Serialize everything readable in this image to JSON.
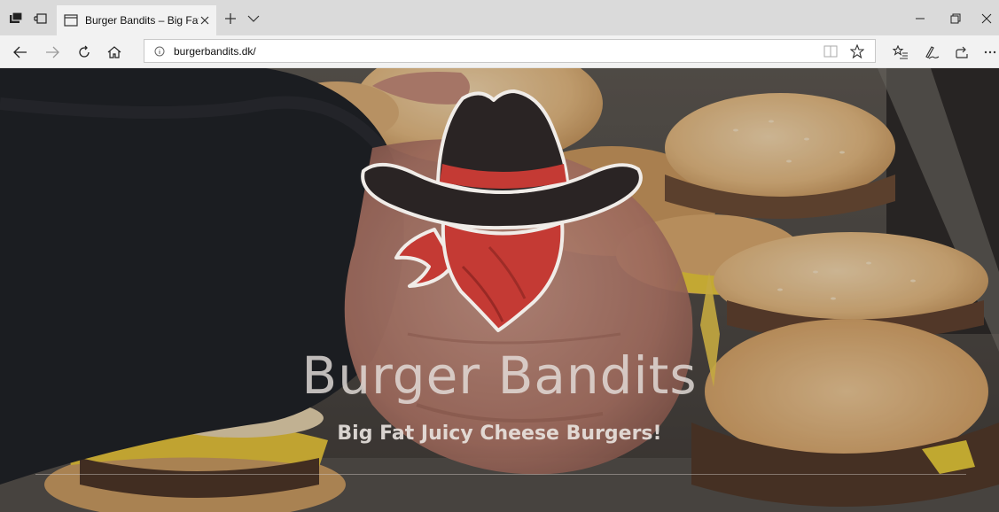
{
  "browser": {
    "tab": {
      "title": "Burger Bandits – Big Fat"
    },
    "address": {
      "url": "burgerbandits.dk/"
    },
    "icons": {
      "set_aside": "set-aside-tabs-icon",
      "tab_preview": "tab-preview-icon",
      "page": "page-icon",
      "close_tab": "close-icon",
      "new_tab": "plus-icon",
      "tab_menu": "chevron-down-icon",
      "minimize": "minimize-icon",
      "restore": "restore-icon",
      "close_window": "close-icon",
      "back": "arrow-left-icon",
      "forward": "arrow-right-icon",
      "refresh": "refresh-icon",
      "home": "home-icon",
      "site_info": "info-icon",
      "reading_view": "reading-view-icon",
      "favorite": "star-icon",
      "favorites_hub": "favorites-list-icon",
      "web_note": "pen-icon",
      "share": "share-icon",
      "more": "more-icon"
    }
  },
  "page": {
    "title": "Burger Bandits",
    "tagline": "Big Fat Juicy Cheese Burgers!",
    "colors": {
      "hat": "#2a2424",
      "hat_outline": "#f0ece8",
      "hat_band": "#c43a34",
      "bandana": "#c43a34",
      "bandana_shadow": "#8e2622"
    }
  }
}
